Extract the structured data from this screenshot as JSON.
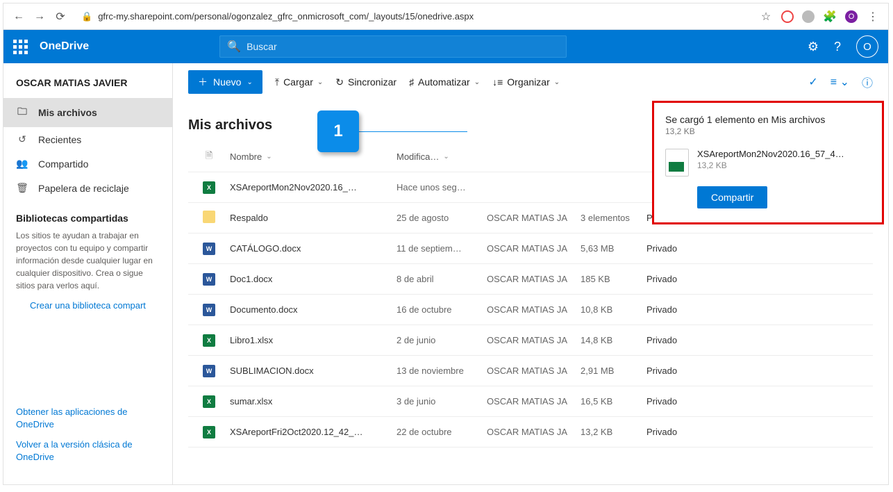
{
  "browser": {
    "url": "gfrc-my.sharepoint.com/personal/ogonzalez_gfrc_onmicrosoft_com/_layouts/15/onedrive.aspx"
  },
  "header": {
    "app": "OneDrive",
    "search_placeholder": "Buscar",
    "avatar_letter": "O"
  },
  "user_name": "OSCAR MATIAS JAVIER",
  "sidebar": {
    "items": [
      {
        "icon": "🗀",
        "label": "Mis archivos"
      },
      {
        "icon": "↺",
        "label": "Recientes"
      },
      {
        "icon": "👥",
        "label": "Compartido"
      },
      {
        "icon": "🗑",
        "label": "Papelera de reciclaje"
      }
    ],
    "section_title": "Bibliotecas compartidas",
    "section_desc": "Los sitios te ayudan a trabajar en proyectos con tu equipo y compartir información desde cualquier lugar en cualquier dispositivo. Crea o sigue sitios para verlos aquí.",
    "create_link": "Crear una biblioteca compart",
    "bottom_links": [
      "Obtener las aplicaciones de OneDrive",
      "Volver a la versión clásica de OneDrive"
    ]
  },
  "toolbar": {
    "new": "Nuevo",
    "upload": "Cargar",
    "sync": "Sincronizar",
    "automate": "Automatizar",
    "organize": "Organizar"
  },
  "page_title": "Mis archivos",
  "cols": {
    "name": "Nombre",
    "modified": "Modifica…"
  },
  "files": [
    {
      "type": "x",
      "name": "XSAreportMon2Nov2020.16_…",
      "modified": "Hace unos seg…",
      "by": "",
      "size": "",
      "share": ""
    },
    {
      "type": "f",
      "name": "Respaldo",
      "modified": "25 de agosto",
      "by": "OSCAR MATIAS JA",
      "size": "3 elementos",
      "share": "Privado"
    },
    {
      "type": "w",
      "name": "CATÁLOGO.docx",
      "modified": "11 de septiem…",
      "by": "OSCAR MATIAS JA",
      "size": "5,63 MB",
      "share": "Privado"
    },
    {
      "type": "w",
      "name": "Doc1.docx",
      "modified": "8 de abril",
      "by": "OSCAR MATIAS JA",
      "size": "185 KB",
      "share": "Privado"
    },
    {
      "type": "w",
      "name": "Documento.docx",
      "modified": "16 de octubre",
      "by": "OSCAR MATIAS JA",
      "size": "10,8 KB",
      "share": "Privado"
    },
    {
      "type": "x",
      "name": "Libro1.xlsx",
      "modified": "2 de junio",
      "by": "OSCAR MATIAS JA",
      "size": "14,8 KB",
      "share": "Privado"
    },
    {
      "type": "w",
      "name": "SUBLIMACION.docx",
      "modified": "13 de noviembre",
      "by": "OSCAR MATIAS JA",
      "size": "2,91 MB",
      "share": "Privado"
    },
    {
      "type": "x",
      "name": "sumar.xlsx",
      "modified": "3 de junio",
      "by": "OSCAR MATIAS JA",
      "size": "16,5 KB",
      "share": "Privado"
    },
    {
      "type": "x",
      "name": "XSAreportFri2Oct2020.12_42_…",
      "modified": "22 de octubre",
      "by": "OSCAR MATIAS JA",
      "size": "13,2 KB",
      "share": "Privado"
    }
  ],
  "toast": {
    "title": "Se cargó 1 elemento en Mis archivos",
    "sub": "13,2 KB",
    "file_name": "XSAreportMon2Nov2020.16_57_4…",
    "file_size": "13,2 KB",
    "share_btn": "Compartir"
  },
  "marker_label": "1"
}
